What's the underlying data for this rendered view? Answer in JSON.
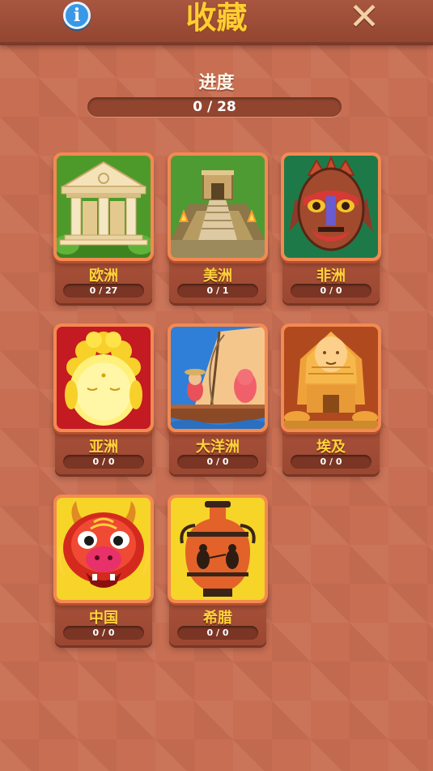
{
  "header": {
    "title": "收藏",
    "info_icon_glyph": "i",
    "close_icon_glyph": "✕"
  },
  "progress": {
    "label": "进度",
    "text": "0 / 28",
    "fraction": 0
  },
  "collections": [
    {
      "name": "欧洲",
      "count": "0 / 27",
      "art": "greek-temple"
    },
    {
      "name": "美洲",
      "count": "0 / 1",
      "art": "maya-pyramid"
    },
    {
      "name": "非洲",
      "count": "0 / 0",
      "art": "tribal-mask"
    },
    {
      "name": "亚洲",
      "count": "0 / 0",
      "art": "golden-buddha"
    },
    {
      "name": "大洋洲",
      "count": "0 / 0",
      "art": "sailing-boat"
    },
    {
      "name": "埃及",
      "count": "0 / 0",
      "art": "sphinx"
    },
    {
      "name": "中国",
      "count": "0 / 0",
      "art": "chinese-dragon"
    },
    {
      "name": "希腊",
      "count": "0 / 0",
      "art": "greek-vase"
    }
  ]
}
